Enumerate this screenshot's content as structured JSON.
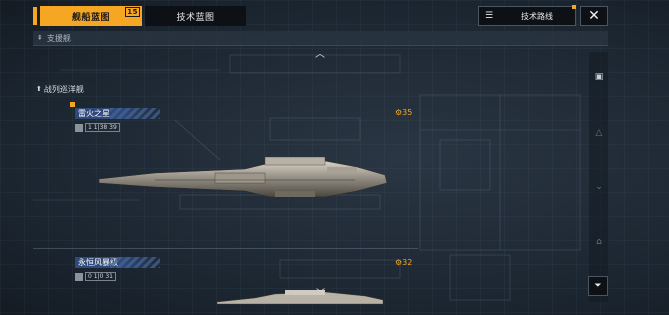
{
  "tabs": [
    {
      "label": "舰船蓝图",
      "badge": "15",
      "active": true
    },
    {
      "label": "技术蓝图",
      "active": false
    }
  ],
  "header": {
    "tech_route_label": "技术路线",
    "tech_route_icon": "list-icon",
    "close_icon": "close-icon"
  },
  "category": {
    "label": "支援舰",
    "icon": "double-chevron-up-icon"
  },
  "section": {
    "label": "战列巡洋舰",
    "icon": "ship-class-icon"
  },
  "ships": [
    {
      "name": "雷火之星",
      "level": "1",
      "meta": "1|38",
      "meta2": "39",
      "cost": "35"
    },
    {
      "name": "永恒风暴级",
      "level": "0",
      "meta": "1|0",
      "meta2": "31",
      "cost": "32"
    }
  ],
  "colors": {
    "accent": "#f5a623",
    "name_bar": "#2f4a7a",
    "background": "#1b2530"
  }
}
